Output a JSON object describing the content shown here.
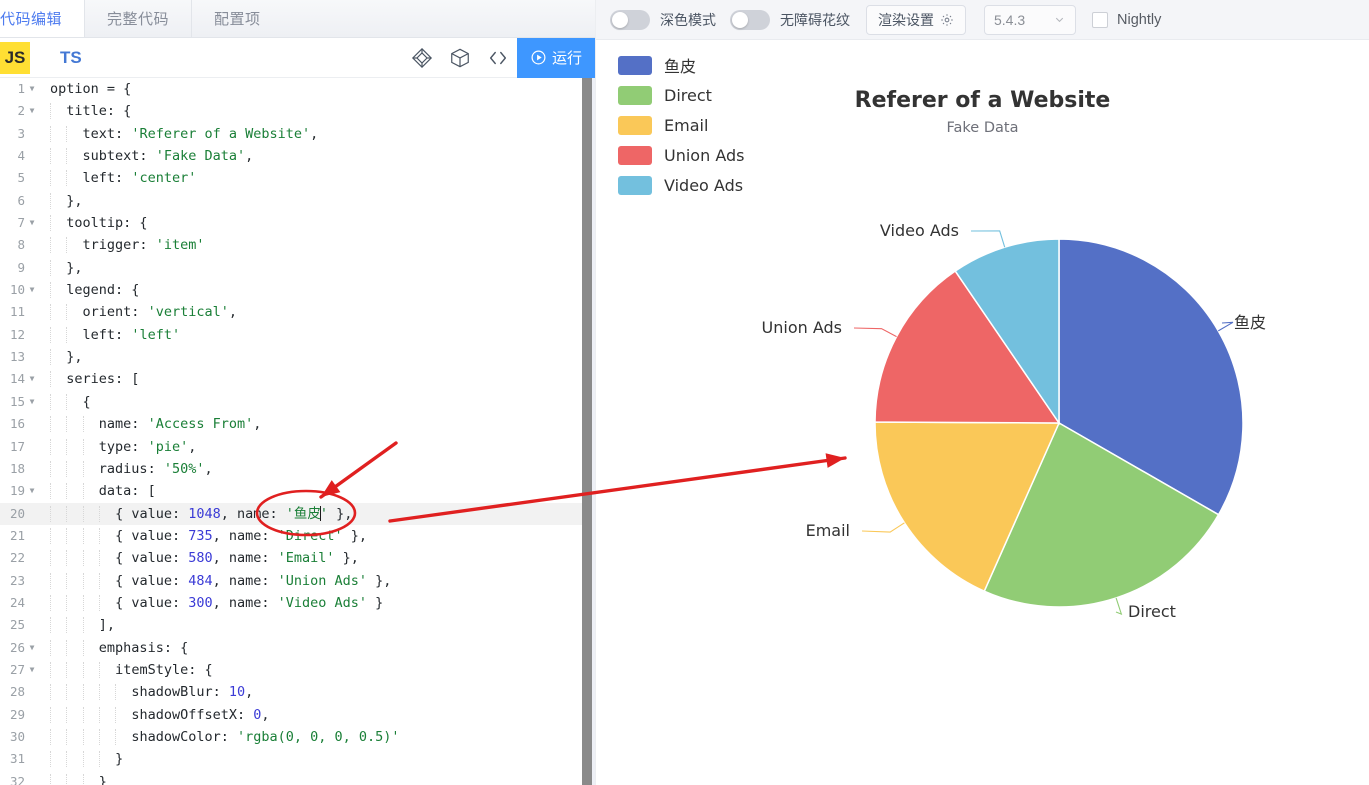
{
  "tabs": [
    {
      "label": "代码编辑",
      "active": true
    },
    {
      "label": "完整代码",
      "active": false
    },
    {
      "label": "配置项",
      "active": false
    }
  ],
  "toolbar": {
    "lang_js": "JS",
    "lang_ts": "TS",
    "icon_polyhedron": "polyhedron-icon",
    "icon_cube": "cube-icon",
    "icon_code": "</>",
    "run_label": "运行"
  },
  "settings": {
    "dark_mode_label": "深色模式",
    "dark_mode_on": false,
    "accessibility_label": "无障碍花纹",
    "accessibility_on": false,
    "render_settings_label": "渲染设置",
    "render_settings_icon": "gear-icon",
    "version_value": "5.4.3",
    "version_caret": "chevron-down-icon",
    "nightly_label": "Nightly",
    "nightly_checked": false
  },
  "editor": {
    "active_line": 20,
    "lines": [
      {
        "n": 1,
        "fold": true,
        "indent": 0,
        "tokens": [
          {
            "t": "option = {",
            "c": "key"
          }
        ]
      },
      {
        "n": 2,
        "fold": true,
        "indent": 1,
        "tokens": [
          {
            "t": "title: {",
            "c": "key"
          }
        ]
      },
      {
        "n": 3,
        "fold": false,
        "indent": 2,
        "tokens": [
          {
            "t": "text: ",
            "c": "key"
          },
          {
            "t": "'Referer of a Website'",
            "c": "str"
          },
          {
            "t": ",",
            "c": "punc"
          }
        ]
      },
      {
        "n": 4,
        "fold": false,
        "indent": 2,
        "tokens": [
          {
            "t": "subtext: ",
            "c": "key"
          },
          {
            "t": "'Fake Data'",
            "c": "str"
          },
          {
            "t": ",",
            "c": "punc"
          }
        ]
      },
      {
        "n": 5,
        "fold": false,
        "indent": 2,
        "tokens": [
          {
            "t": "left: ",
            "c": "key"
          },
          {
            "t": "'center'",
            "c": "str"
          }
        ]
      },
      {
        "n": 6,
        "fold": false,
        "indent": 1,
        "tokens": [
          {
            "t": "},",
            "c": "punc"
          }
        ]
      },
      {
        "n": 7,
        "fold": true,
        "indent": 1,
        "tokens": [
          {
            "t": "tooltip: {",
            "c": "key"
          }
        ]
      },
      {
        "n": 8,
        "fold": false,
        "indent": 2,
        "tokens": [
          {
            "t": "trigger: ",
            "c": "key"
          },
          {
            "t": "'item'",
            "c": "str"
          }
        ]
      },
      {
        "n": 9,
        "fold": false,
        "indent": 1,
        "tokens": [
          {
            "t": "},",
            "c": "punc"
          }
        ]
      },
      {
        "n": 10,
        "fold": true,
        "indent": 1,
        "tokens": [
          {
            "t": "legend: {",
            "c": "key"
          }
        ]
      },
      {
        "n": 11,
        "fold": false,
        "indent": 2,
        "tokens": [
          {
            "t": "orient: ",
            "c": "key"
          },
          {
            "t": "'vertical'",
            "c": "str"
          },
          {
            "t": ",",
            "c": "punc"
          }
        ]
      },
      {
        "n": 12,
        "fold": false,
        "indent": 2,
        "tokens": [
          {
            "t": "left: ",
            "c": "key"
          },
          {
            "t": "'left'",
            "c": "str"
          }
        ]
      },
      {
        "n": 13,
        "fold": false,
        "indent": 1,
        "tokens": [
          {
            "t": "},",
            "c": "punc"
          }
        ]
      },
      {
        "n": 14,
        "fold": true,
        "indent": 1,
        "tokens": [
          {
            "t": "series: [",
            "c": "key"
          }
        ]
      },
      {
        "n": 15,
        "fold": true,
        "indent": 2,
        "tokens": [
          {
            "t": "{",
            "c": "punc"
          }
        ]
      },
      {
        "n": 16,
        "fold": false,
        "indent": 3,
        "tokens": [
          {
            "t": "name: ",
            "c": "key"
          },
          {
            "t": "'Access From'",
            "c": "str"
          },
          {
            "t": ",",
            "c": "punc"
          }
        ]
      },
      {
        "n": 17,
        "fold": false,
        "indent": 3,
        "tokens": [
          {
            "t": "type: ",
            "c": "key"
          },
          {
            "t": "'pie'",
            "c": "str"
          },
          {
            "t": ",",
            "c": "punc"
          }
        ]
      },
      {
        "n": 18,
        "fold": false,
        "indent": 3,
        "tokens": [
          {
            "t": "radius: ",
            "c": "key"
          },
          {
            "t": "'50%'",
            "c": "str"
          },
          {
            "t": ",",
            "c": "punc"
          }
        ]
      },
      {
        "n": 19,
        "fold": true,
        "indent": 3,
        "tokens": [
          {
            "t": "data: [",
            "c": "key"
          }
        ]
      },
      {
        "n": 20,
        "fold": false,
        "indent": 4,
        "tokens": [
          {
            "t": "{ value: ",
            "c": "key"
          },
          {
            "t": "1048",
            "c": "num"
          },
          {
            "t": ", name: ",
            "c": "key"
          },
          {
            "t": "'鱼皮",
            "c": "str"
          },
          {
            "t": "|CARET|",
            "c": "caret"
          },
          {
            "t": "'",
            "c": "str"
          },
          {
            "t": " },",
            "c": "punc"
          }
        ]
      },
      {
        "n": 21,
        "fold": false,
        "indent": 4,
        "tokens": [
          {
            "t": "{ value: ",
            "c": "key"
          },
          {
            "t": "735",
            "c": "num"
          },
          {
            "t": ", name: ",
            "c": "key"
          },
          {
            "t": "'Direct'",
            "c": "str"
          },
          {
            "t": " },",
            "c": "punc"
          }
        ]
      },
      {
        "n": 22,
        "fold": false,
        "indent": 4,
        "tokens": [
          {
            "t": "{ value: ",
            "c": "key"
          },
          {
            "t": "580",
            "c": "num"
          },
          {
            "t": ", name: ",
            "c": "key"
          },
          {
            "t": "'Email'",
            "c": "str"
          },
          {
            "t": " },",
            "c": "punc"
          }
        ]
      },
      {
        "n": 23,
        "fold": false,
        "indent": 4,
        "tokens": [
          {
            "t": "{ value: ",
            "c": "key"
          },
          {
            "t": "484",
            "c": "num"
          },
          {
            "t": ", name: ",
            "c": "key"
          },
          {
            "t": "'Union Ads'",
            "c": "str"
          },
          {
            "t": " },",
            "c": "punc"
          }
        ]
      },
      {
        "n": 24,
        "fold": false,
        "indent": 4,
        "tokens": [
          {
            "t": "{ value: ",
            "c": "key"
          },
          {
            "t": "300",
            "c": "num"
          },
          {
            "t": ", name: ",
            "c": "key"
          },
          {
            "t": "'Video Ads'",
            "c": "str"
          },
          {
            "t": " }",
            "c": "punc"
          }
        ]
      },
      {
        "n": 25,
        "fold": false,
        "indent": 3,
        "tokens": [
          {
            "t": "],",
            "c": "punc"
          }
        ]
      },
      {
        "n": 26,
        "fold": true,
        "indent": 3,
        "tokens": [
          {
            "t": "emphasis: {",
            "c": "key"
          }
        ]
      },
      {
        "n": 27,
        "fold": true,
        "indent": 4,
        "tokens": [
          {
            "t": "itemStyle: {",
            "c": "key"
          }
        ]
      },
      {
        "n": 28,
        "fold": false,
        "indent": 5,
        "tokens": [
          {
            "t": "shadowBlur: ",
            "c": "key"
          },
          {
            "t": "10",
            "c": "num"
          },
          {
            "t": ",",
            "c": "punc"
          }
        ]
      },
      {
        "n": 29,
        "fold": false,
        "indent": 5,
        "tokens": [
          {
            "t": "shadowOffsetX: ",
            "c": "key"
          },
          {
            "t": "0",
            "c": "num"
          },
          {
            "t": ",",
            "c": "punc"
          }
        ]
      },
      {
        "n": 30,
        "fold": false,
        "indent": 5,
        "tokens": [
          {
            "t": "shadowColor: ",
            "c": "key"
          },
          {
            "t": "'rgba(0, 0, 0, 0.5)'",
            "c": "str"
          }
        ]
      },
      {
        "n": 31,
        "fold": false,
        "indent": 4,
        "tokens": [
          {
            "t": "}",
            "c": "punc"
          }
        ]
      },
      {
        "n": 32,
        "fold": false,
        "indent": 3,
        "tokens": [
          {
            "t": "}",
            "c": "punc"
          }
        ]
      }
    ]
  },
  "chart_data": {
    "type": "pie",
    "title": "Referer of a Website",
    "subtitle": "Fake Data",
    "series_name": "Access From",
    "radius": "50%",
    "legend_orient": "vertical",
    "legend_position": "left",
    "categories": [
      "鱼皮",
      "Direct",
      "Email",
      "Union Ads",
      "Video Ads"
    ],
    "values": [
      1048,
      735,
      580,
      484,
      300
    ],
    "colors": [
      "#5470c6",
      "#91cc75",
      "#fac858",
      "#ee6666",
      "#73c0de"
    ],
    "labels": [
      "鱼皮",
      "Direct",
      "Email",
      "Union Ads",
      "Video Ads"
    ],
    "legend": [
      {
        "label": "鱼皮",
        "color": "#5470c6"
      },
      {
        "label": "Direct",
        "color": "#91cc75"
      },
      {
        "label": "Email",
        "color": "#fac858"
      },
      {
        "label": "Union Ads",
        "color": "#ee6666"
      },
      {
        "label": "Video Ads",
        "color": "#73c0de"
      }
    ]
  },
  "annotations": {
    "color": "#e02020",
    "ellipse_target": "鱼皮",
    "arrow_short": "points-to-edited-string",
    "arrow_long": "points-from-code-to-chart"
  }
}
